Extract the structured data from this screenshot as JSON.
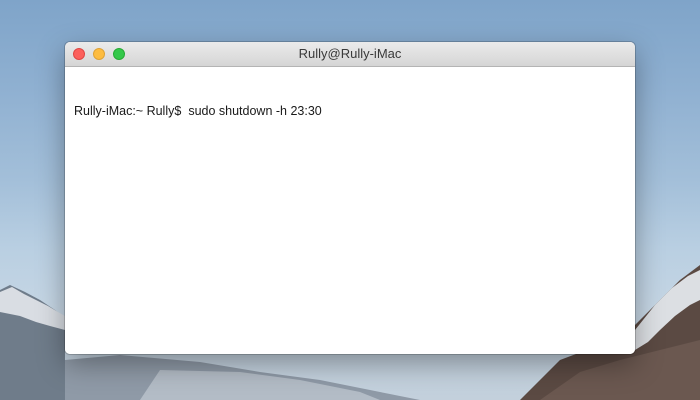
{
  "window": {
    "title": "Rully@Rully-iMac"
  },
  "terminal": {
    "prompt": "Rully-iMac:~ Rully$",
    "command": "sudo shutdown -h 23:30"
  },
  "colors": {
    "close": "#fc605c",
    "minimize": "#fdbc40",
    "zoom": "#34c84a",
    "sky_top": "#7fa4c9"
  }
}
